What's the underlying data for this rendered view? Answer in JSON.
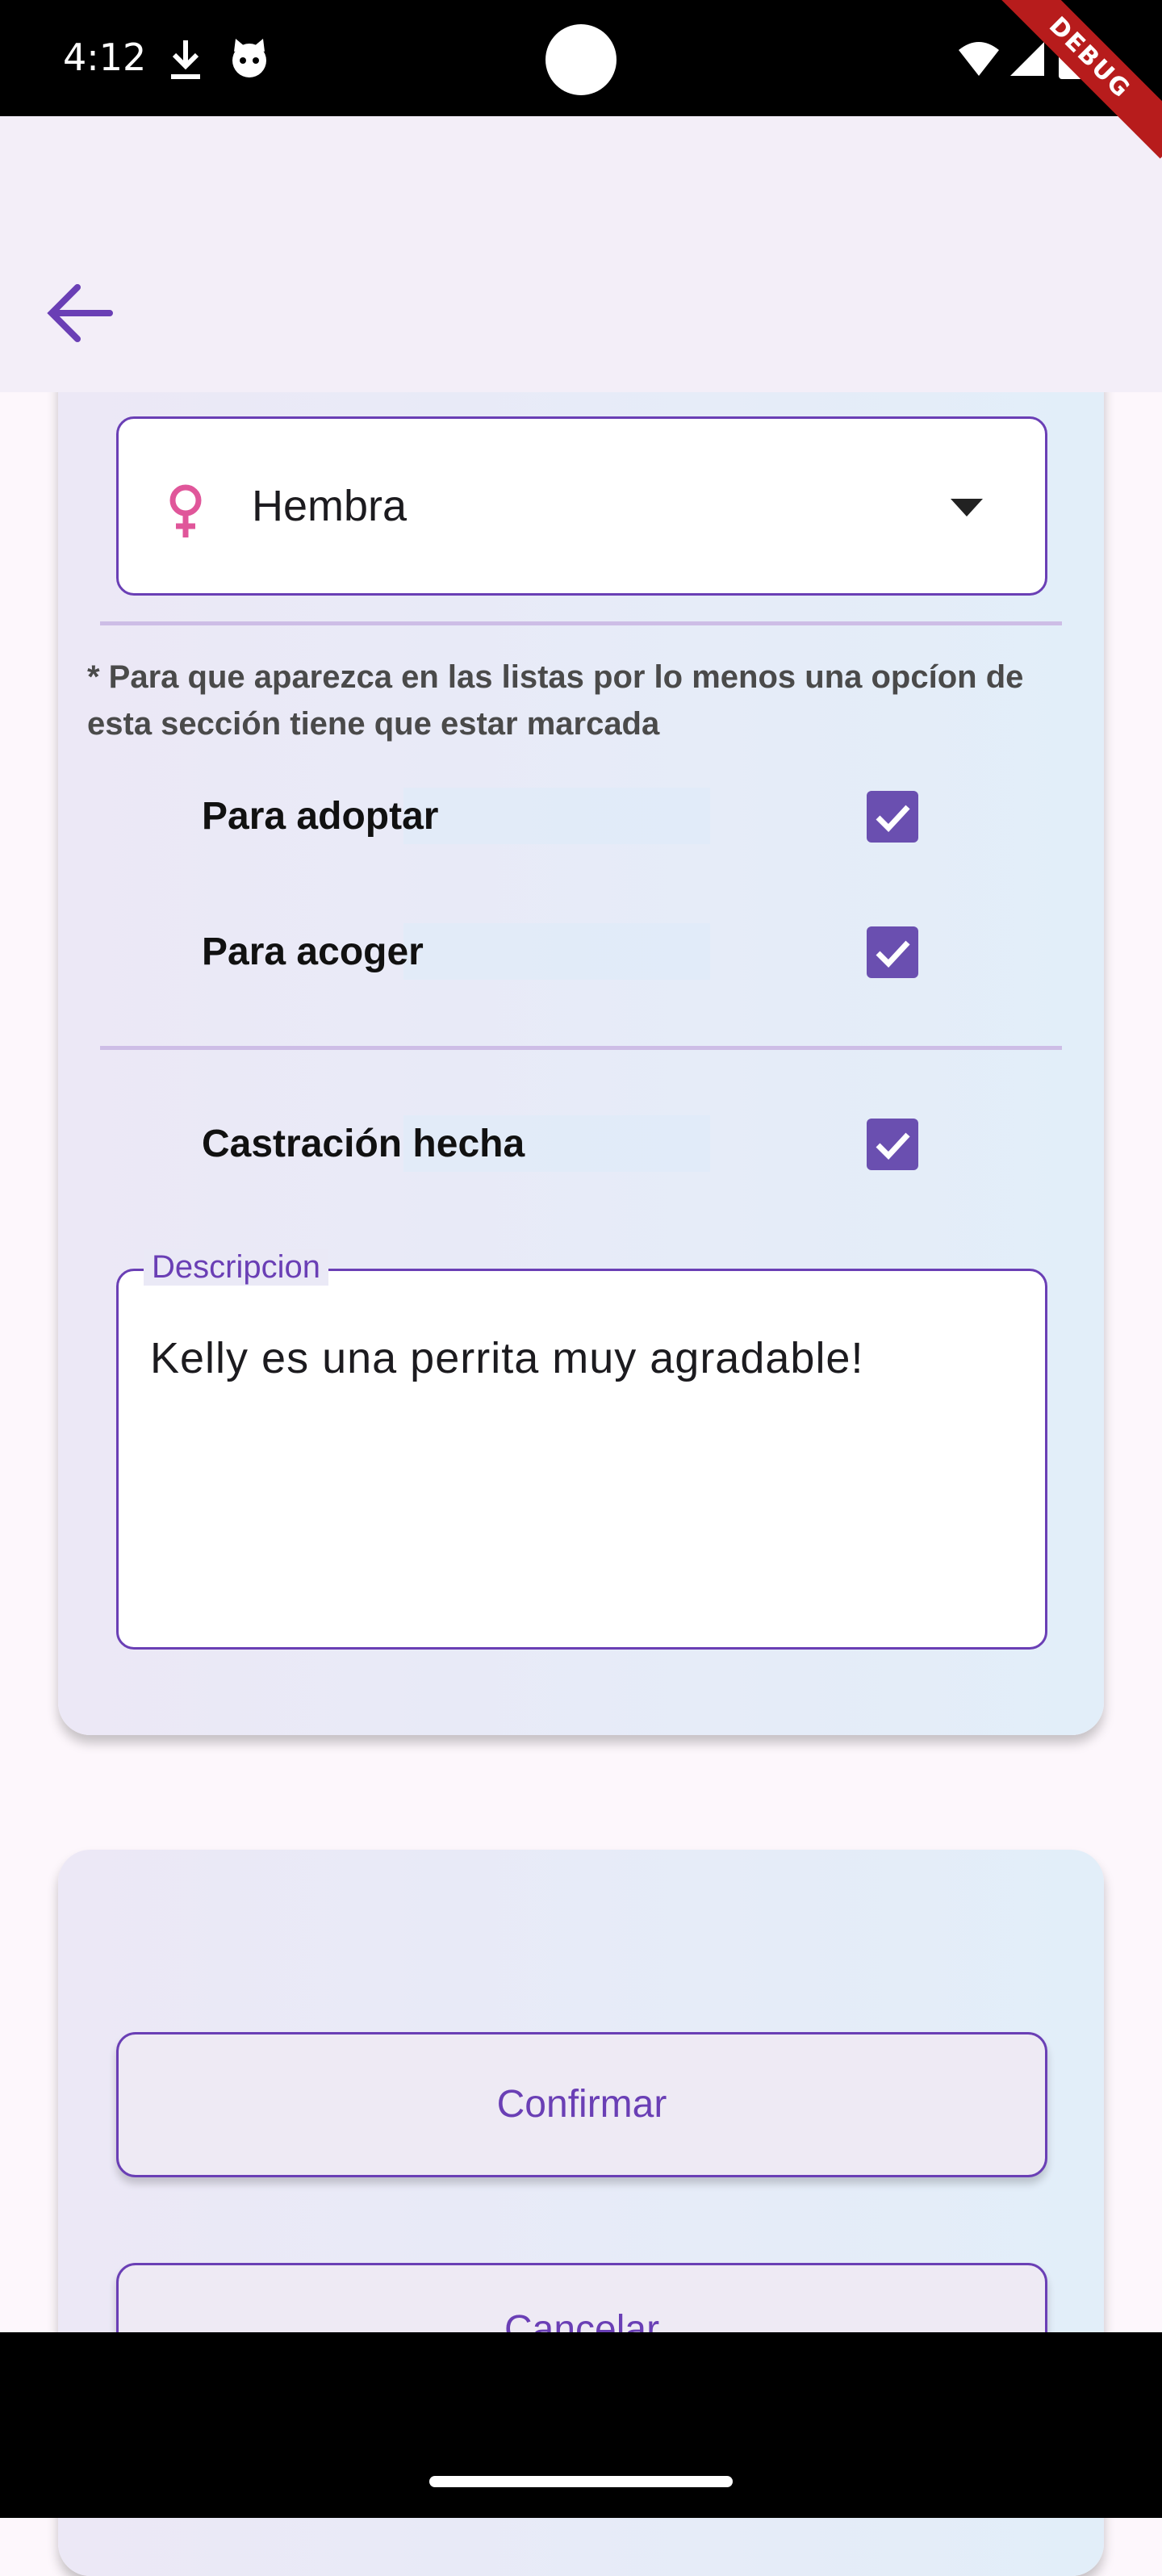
{
  "status_bar": {
    "time": "4:12"
  },
  "debug_banner": "DEBUG",
  "sex_field": {
    "value": "Hembra"
  },
  "note": "* Para que aparezca en las listas por lo menos una opcíon de esta sección tiene que estar marcada",
  "options": [
    {
      "label": "Para adoptar",
      "checked": true
    },
    {
      "label": "Para acoger",
      "checked": true
    }
  ],
  "castration": {
    "label": "Castración hecha",
    "checked": true
  },
  "description": {
    "label": "Descripcion",
    "value": "Kelly es una perrita muy agradable!"
  },
  "buttons": {
    "confirm": "Confirmar",
    "cancel": "Cancelar"
  },
  "colors": {
    "accent": "#6a3fb5",
    "female_icon": "#e0569a",
    "checkbox": "#6a4fb0"
  }
}
